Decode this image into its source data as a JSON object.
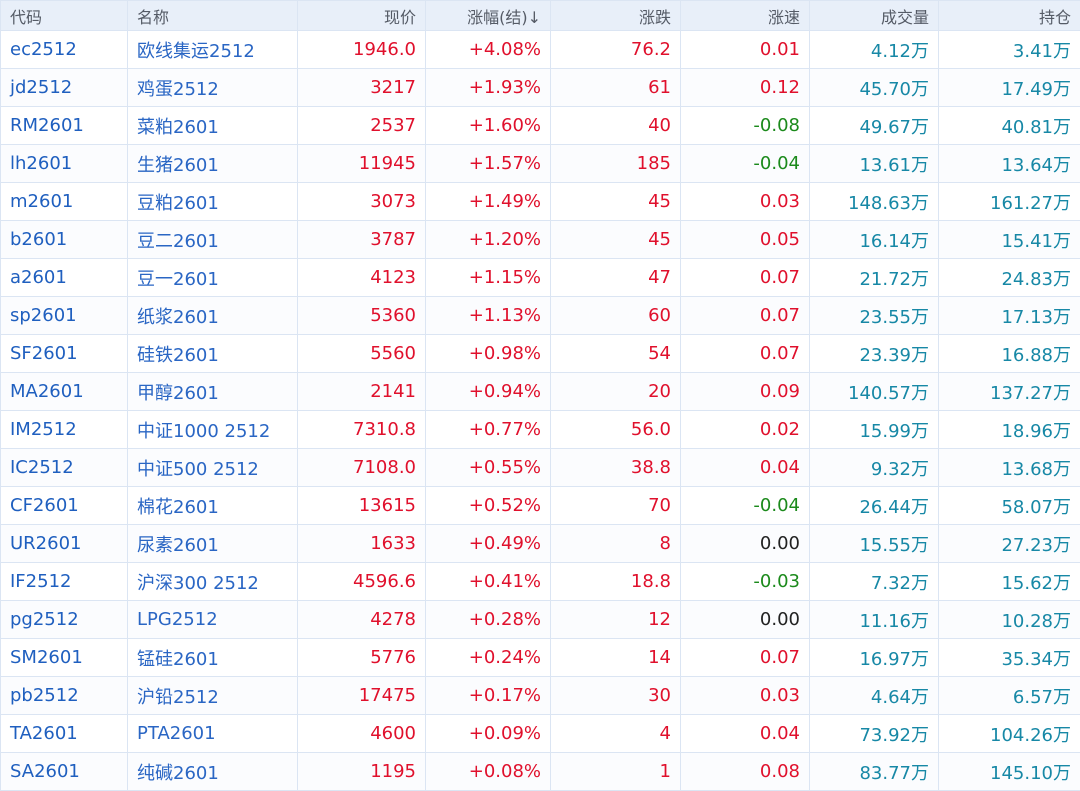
{
  "headers": {
    "code": "代码",
    "name": "名称",
    "price": "现价",
    "pct": "涨幅(结)↓",
    "chg": "涨跌",
    "speed": "涨速",
    "volume": "成交量",
    "oi": "持仓"
  },
  "colors": {
    "up": "#e0102c",
    "down": "#1b8a1b",
    "flat": "#222222",
    "volume": "#1788a6",
    "code": "#1f5fbf"
  },
  "rows": [
    {
      "code": "ec2512",
      "name": "欧线集运2512",
      "price": "1946.0",
      "pct": "+4.08%",
      "chg": "76.2",
      "speed": "0.01",
      "volume": "4.12万",
      "oi": "3.41万"
    },
    {
      "code": "jd2512",
      "name": "鸡蛋2512",
      "price": "3217",
      "pct": "+1.93%",
      "chg": "61",
      "speed": "0.12",
      "volume": "45.70万",
      "oi": "17.49万"
    },
    {
      "code": "RM2601",
      "name": "菜粕2601",
      "price": "2537",
      "pct": "+1.60%",
      "chg": "40",
      "speed": "-0.08",
      "volume": "49.67万",
      "oi": "40.81万"
    },
    {
      "code": "lh2601",
      "name": "生猪2601",
      "price": "11945",
      "pct": "+1.57%",
      "chg": "185",
      "speed": "-0.04",
      "volume": "13.61万",
      "oi": "13.64万"
    },
    {
      "code": "m2601",
      "name": "豆粕2601",
      "price": "3073",
      "pct": "+1.49%",
      "chg": "45",
      "speed": "0.03",
      "volume": "148.63万",
      "oi": "161.27万"
    },
    {
      "code": "b2601",
      "name": "豆二2601",
      "price": "3787",
      "pct": "+1.20%",
      "chg": "45",
      "speed": "0.05",
      "volume": "16.14万",
      "oi": "15.41万"
    },
    {
      "code": "a2601",
      "name": "豆一2601",
      "price": "4123",
      "pct": "+1.15%",
      "chg": "47",
      "speed": "0.07",
      "volume": "21.72万",
      "oi": "24.83万"
    },
    {
      "code": "sp2601",
      "name": "纸浆2601",
      "price": "5360",
      "pct": "+1.13%",
      "chg": "60",
      "speed": "0.07",
      "volume": "23.55万",
      "oi": "17.13万"
    },
    {
      "code": "SF2601",
      "name": "硅铁2601",
      "price": "5560",
      "pct": "+0.98%",
      "chg": "54",
      "speed": "0.07",
      "volume": "23.39万",
      "oi": "16.88万"
    },
    {
      "code": "MA2601",
      "name": "甲醇2601",
      "price": "2141",
      "pct": "+0.94%",
      "chg": "20",
      "speed": "0.09",
      "volume": "140.57万",
      "oi": "137.27万"
    },
    {
      "code": "IM2512",
      "name": "中证1000 2512",
      "price": "7310.8",
      "pct": "+0.77%",
      "chg": "56.0",
      "speed": "0.02",
      "volume": "15.99万",
      "oi": "18.96万"
    },
    {
      "code": "IC2512",
      "name": "中证500 2512",
      "price": "7108.0",
      "pct": "+0.55%",
      "chg": "38.8",
      "speed": "0.04",
      "volume": "9.32万",
      "oi": "13.68万"
    },
    {
      "code": "CF2601",
      "name": "棉花2601",
      "price": "13615",
      "pct": "+0.52%",
      "chg": "70",
      "speed": "-0.04",
      "volume": "26.44万",
      "oi": "58.07万"
    },
    {
      "code": "UR2601",
      "name": "尿素2601",
      "price": "1633",
      "pct": "+0.49%",
      "chg": "8",
      "speed": "0.00",
      "volume": "15.55万",
      "oi": "27.23万"
    },
    {
      "code": "IF2512",
      "name": "沪深300 2512",
      "price": "4596.6",
      "pct": "+0.41%",
      "chg": "18.8",
      "speed": "-0.03",
      "volume": "7.32万",
      "oi": "15.62万"
    },
    {
      "code": "pg2512",
      "name": "LPG2512",
      "price": "4278",
      "pct": "+0.28%",
      "chg": "12",
      "speed": "0.00",
      "volume": "11.16万",
      "oi": "10.28万"
    },
    {
      "code": "SM2601",
      "name": "锰硅2601",
      "price": "5776",
      "pct": "+0.24%",
      "chg": "14",
      "speed": "0.07",
      "volume": "16.97万",
      "oi": "35.34万"
    },
    {
      "code": "pb2512",
      "name": "沪铅2512",
      "price": "17475",
      "pct": "+0.17%",
      "chg": "30",
      "speed": "0.03",
      "volume": "4.64万",
      "oi": "6.57万"
    },
    {
      "code": "TA2601",
      "name": "PTA2601",
      "price": "4600",
      "pct": "+0.09%",
      "chg": "4",
      "speed": "0.04",
      "volume": "73.92万",
      "oi": "104.26万"
    },
    {
      "code": "SA2601",
      "name": "纯碱2601",
      "price": "1195",
      "pct": "+0.08%",
      "chg": "1",
      "speed": "0.08",
      "volume": "83.77万",
      "oi": "145.10万"
    }
  ]
}
